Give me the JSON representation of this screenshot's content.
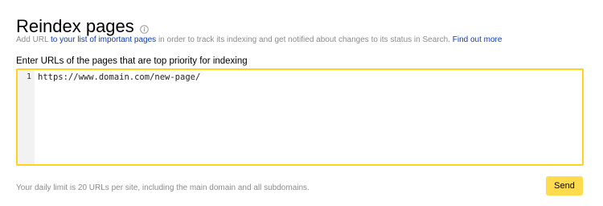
{
  "header": {
    "title": "Reindex pages",
    "info_icon": "info-circle-icon"
  },
  "subtitle": {
    "text_before": "Add URL ",
    "link_list": "to your list of important pages",
    "text_middle": " in order to track its indexing and get notified about changes to its status in Search. ",
    "link_more": "Find out more"
  },
  "form": {
    "label": "Enter URLs of the pages that are top priority for indexing",
    "line_numbers": [
      "1"
    ],
    "lines": [
      "https://www.domain.com/new-page/"
    ],
    "focus_border_color": "#ffd21f"
  },
  "footer": {
    "note": "Your daily limit is 20 URLs per site, including the main domain and all subdomains.",
    "send_label": "Send"
  },
  "colors": {
    "accent": "#ffdb4d",
    "link": "#0a3bb8",
    "muted_text": "#8b8b8b"
  }
}
